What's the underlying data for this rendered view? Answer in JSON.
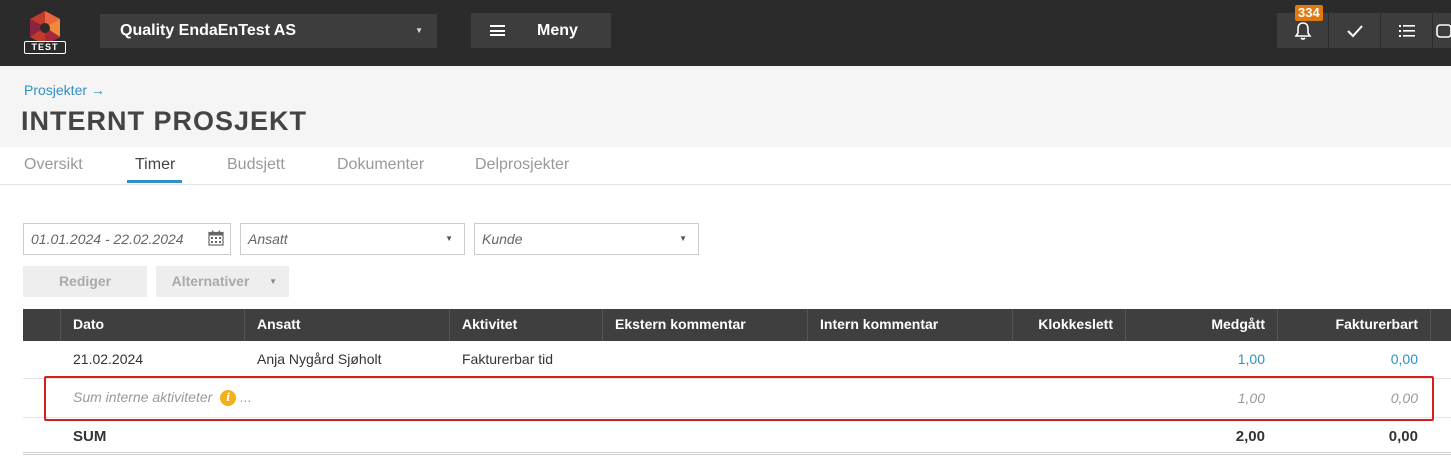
{
  "topbar": {
    "logo_text": "TEST",
    "company": "Quality EndaEnTest AS",
    "menu_label": "Meny",
    "notification_count": "334"
  },
  "header": {
    "breadcrumb": "Prosjekter →",
    "title": "INTERNT PROSJEKT"
  },
  "tabs": [
    {
      "label": "Oversikt"
    },
    {
      "label": "Timer"
    },
    {
      "label": "Budsjett"
    },
    {
      "label": "Dokumenter"
    },
    {
      "label": "Delprosjekter"
    }
  ],
  "active_tab": "Timer",
  "filters": {
    "date_range": "01.01.2024 - 22.02.2024",
    "ansatt_placeholder": "Ansatt",
    "kunde_placeholder": "Kunde"
  },
  "actions": {
    "edit": "Rediger",
    "alternatives": "Alternativer"
  },
  "table": {
    "columns": [
      "Dato",
      "Ansatt",
      "Aktivitet",
      "Ekstern kommentar",
      "Intern kommentar",
      "Klokkeslett",
      "Medgått",
      "Fakturerbart"
    ],
    "rows": [
      {
        "dato": "21.02.2024",
        "ansatt": "Anja Nygård Sjøholt",
        "aktivitet": "Fakturerbar tid",
        "ekstern": "",
        "intern": "",
        "klokkeslett": "",
        "medgatt": "1,00",
        "fakturerbart": "0,00"
      }
    ],
    "sum_internal": {
      "label": "Sum interne aktiviteter",
      "info": "i",
      "ellipsis": "...",
      "medgatt": "1,00",
      "fakturerbart": "0,00"
    },
    "sum": {
      "label": "SUM",
      "medgatt": "2,00",
      "fakturerbart": "0,00"
    }
  },
  "colors": {
    "accent": "#2f8fc6",
    "topbar": "#2b2b2b",
    "badge": "#e07a10",
    "highlight": "#d61e1e"
  }
}
